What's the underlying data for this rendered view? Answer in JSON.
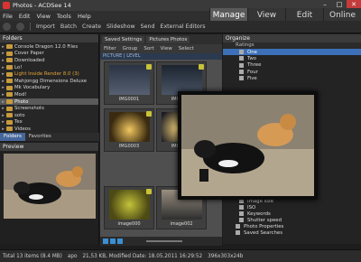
{
  "window": {
    "title": "Photos - ACDSee 14"
  },
  "menu": [
    "File",
    "Edit",
    "View",
    "Tools",
    "Help"
  ],
  "modes": [
    "Manage",
    "View",
    "Edit",
    "Online"
  ],
  "toolbar": {
    "import": "Import",
    "batch": "Batch",
    "create": "Create",
    "slideshow": "Slideshow",
    "send": "Send",
    "external_editors": "External Editors"
  },
  "folders_panel": {
    "title": "Folders",
    "items": [
      {
        "label": "Console Dragon 12.0 Files",
        "warn": false
      },
      {
        "label": "Cover Paper",
        "warn": false
      },
      {
        "label": "Downloaded",
        "warn": false
      },
      {
        "label": "Lo!",
        "warn": false
      },
      {
        "label": "Light Inside Render 8.0 (3)",
        "warn": true
      },
      {
        "label": "Mahjongg Dimensions Deluxe",
        "warn": false
      },
      {
        "label": "Mk Vocabulary",
        "warn": false
      },
      {
        "label": "Mod!",
        "warn": false
      },
      {
        "label": "Photo",
        "warn": false
      },
      {
        "label": "Screenshots",
        "warn": false
      },
      {
        "label": "soto",
        "warn": false
      },
      {
        "label": "Tex",
        "warn": false
      },
      {
        "label": "Videos",
        "warn": false
      }
    ],
    "selected_index": 8,
    "tabs": [
      "Folders",
      "Favorites"
    ]
  },
  "preview_panel": {
    "title": "Preview"
  },
  "browser": {
    "crumbs": [
      "Saved Settings",
      "Pictures Photos"
    ],
    "subtoolbar": [
      "Filter",
      "Group",
      "Sort",
      "View",
      "Select"
    ],
    "group_header": "PICTURE | LEVEL",
    "thumbs": [
      {
        "caption": "IMG0001"
      },
      {
        "caption": "IMG0002"
      },
      {
        "caption": "IMG0003"
      },
      {
        "caption": "IMG0004"
      },
      {
        "caption": "image000"
      },
      {
        "caption": "image002"
      }
    ]
  },
  "organize_panel": {
    "title": "Organize",
    "ratings_label": "Ratings",
    "ratings": [
      "One",
      "Two",
      "Three",
      "Four",
      "Five"
    ],
    "selected_rating_index": 0,
    "properties": [
      "Focal length",
      "Image size",
      "ISO",
      "Keywords",
      "Shutter speed"
    ],
    "groups": [
      "Photo Properties",
      "Saved Searches"
    ]
  },
  "statusbar": {
    "total": "Total 13 items (8.4 MB)",
    "folder": "apo",
    "file_info": "21,53 KB, Modified Date: 18.05.2011 16:29:52",
    "dimensions": "396x303x24b"
  },
  "colors": {
    "accent": "#3c70b8",
    "warning": "#e3a43a"
  }
}
